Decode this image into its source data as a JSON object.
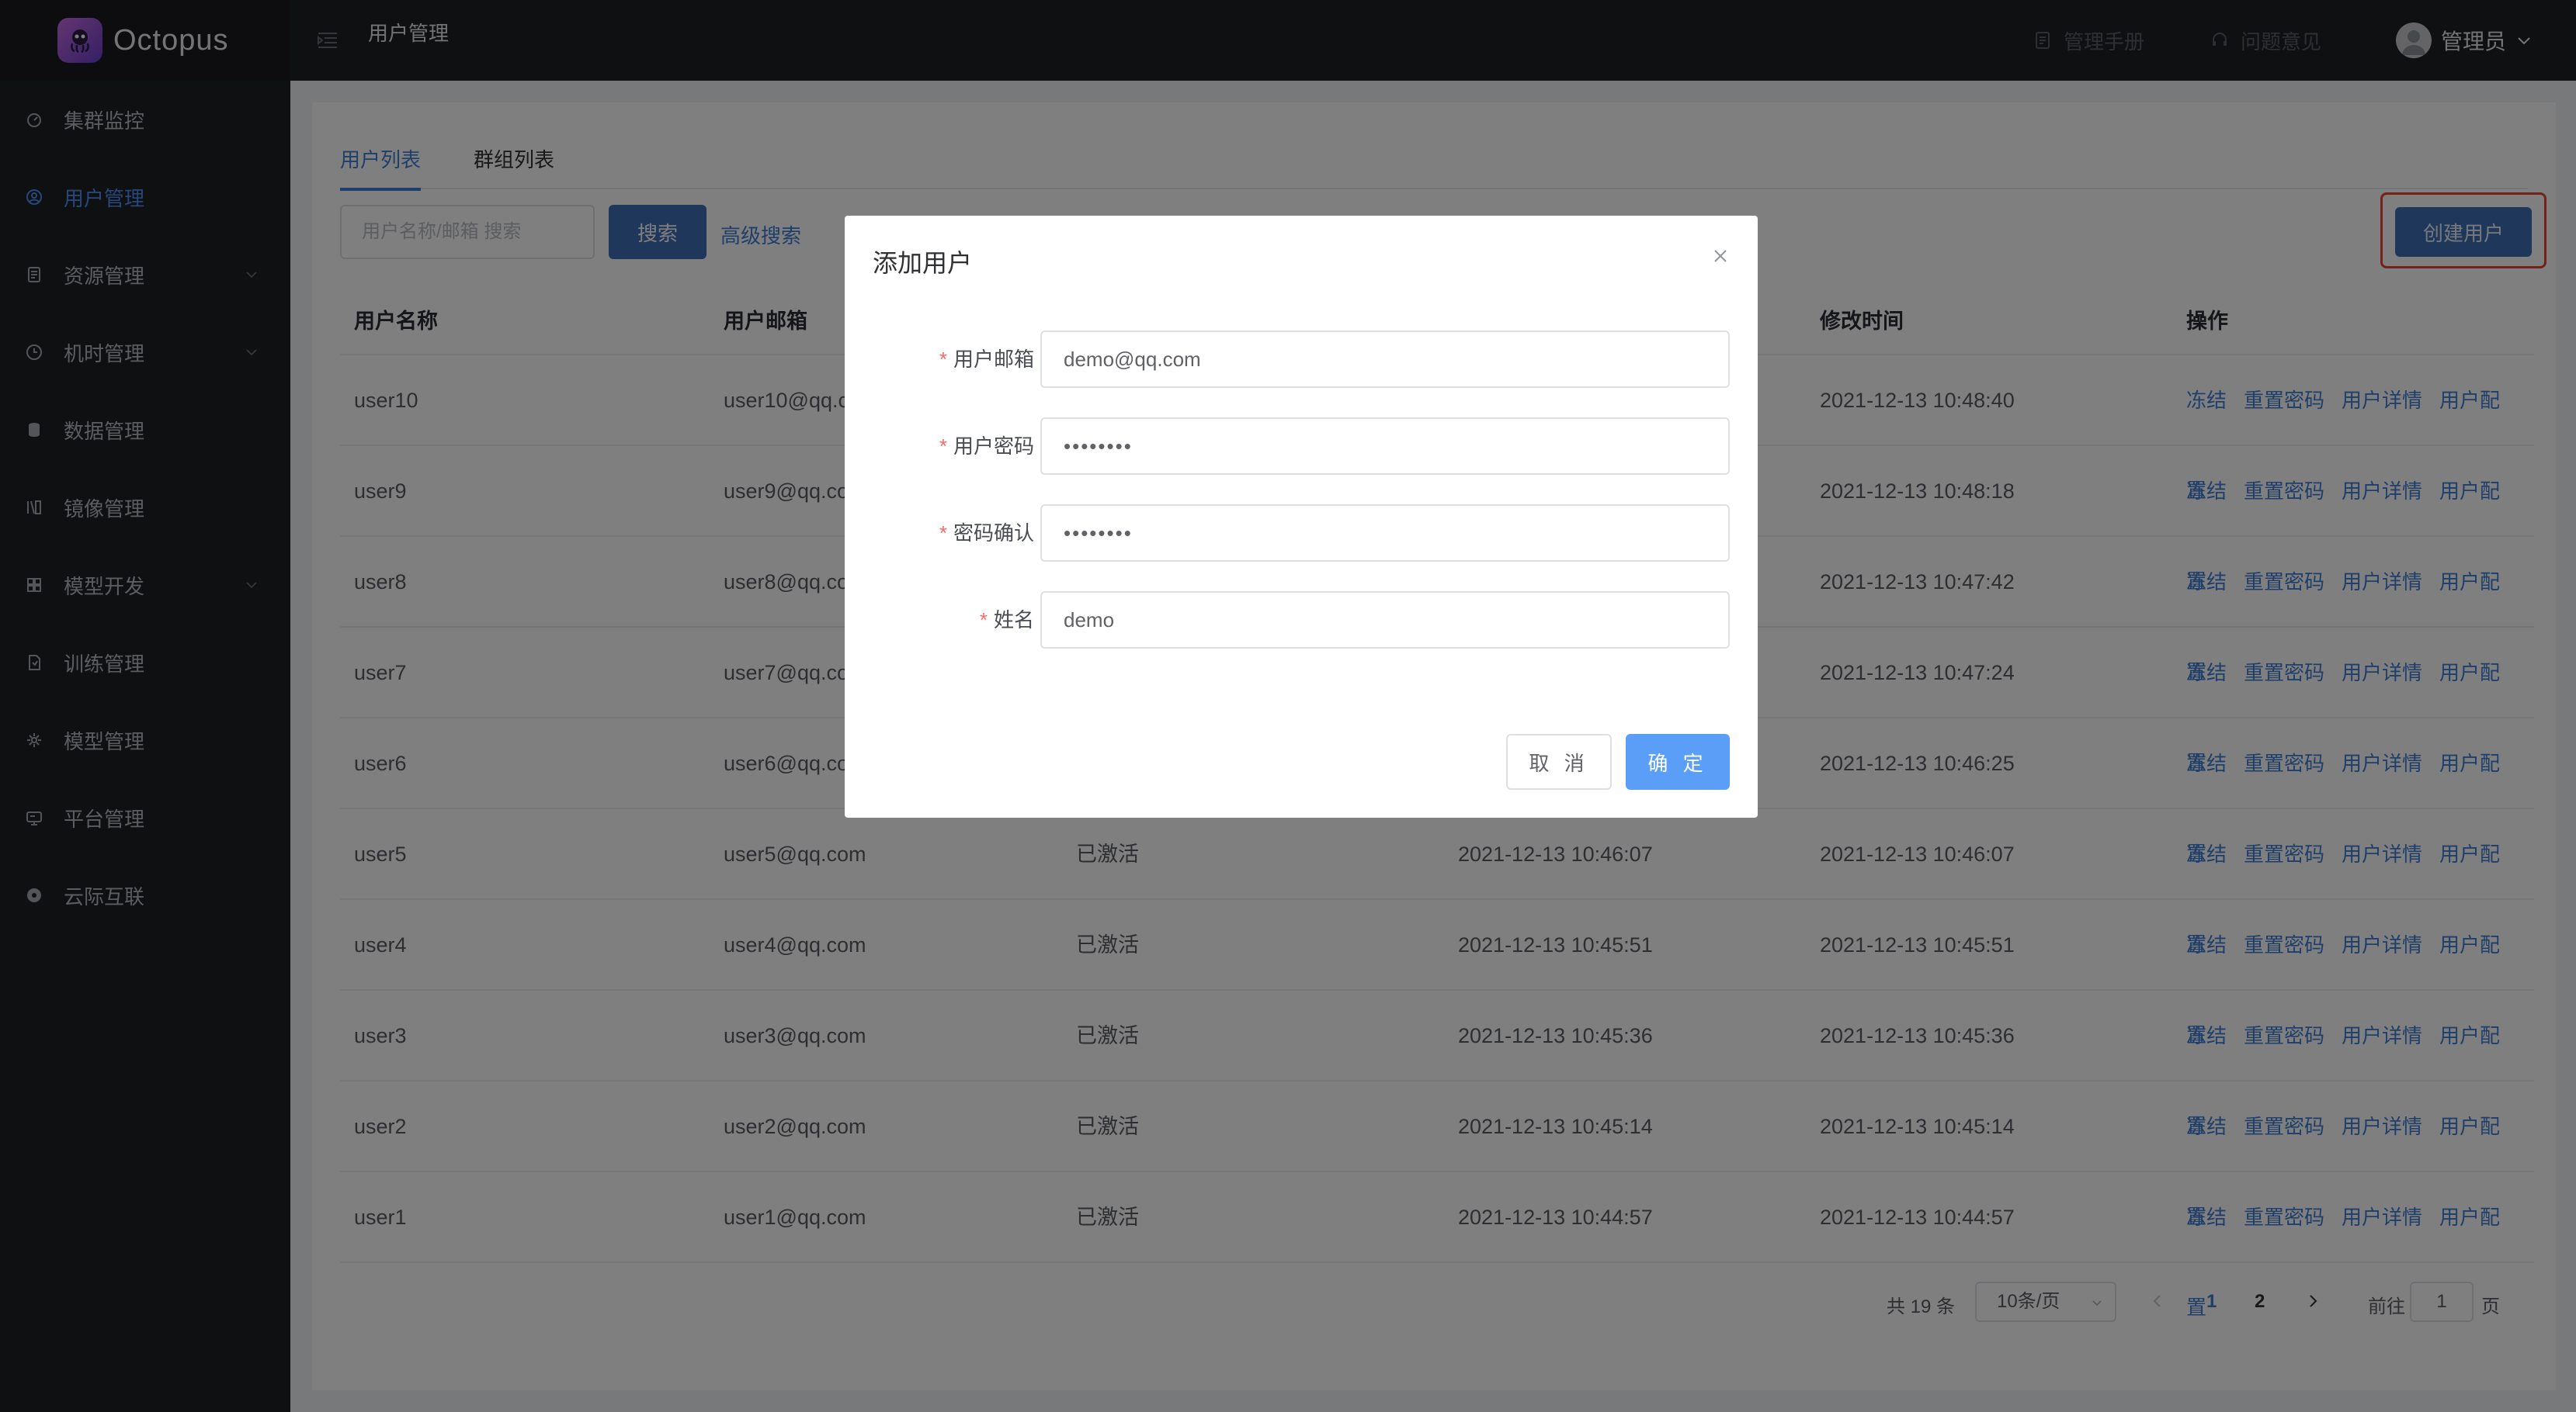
{
  "app": {
    "name": "Octopus",
    "page": "用户管理"
  },
  "sidebar": {
    "items": [
      {
        "label": "集群监控",
        "icon": "monitor-icon",
        "expandable": false,
        "active": false
      },
      {
        "label": "用户管理",
        "icon": "user-icon",
        "expandable": false,
        "active": true
      },
      {
        "label": "资源管理",
        "icon": "resource-icon",
        "expandable": true,
        "active": false
      },
      {
        "label": "机时管理",
        "icon": "clock-icon",
        "expandable": true,
        "active": false
      },
      {
        "label": "数据管理",
        "icon": "database-icon",
        "expandable": false,
        "active": false
      },
      {
        "label": "镜像管理",
        "icon": "image-icon",
        "expandable": false,
        "active": false
      },
      {
        "label": "模型开发",
        "icon": "dev-icon",
        "expandable": true,
        "active": false
      },
      {
        "label": "训练管理",
        "icon": "train-icon",
        "expandable": false,
        "active": false
      },
      {
        "label": "模型管理",
        "icon": "model-icon",
        "expandable": false,
        "active": false
      },
      {
        "label": "平台管理",
        "icon": "platform-icon",
        "expandable": false,
        "active": false
      },
      {
        "label": "云际互联",
        "icon": "cloud-icon",
        "expandable": false,
        "active": false
      }
    ]
  },
  "header": {
    "manual": "管理手册",
    "feedback": "问题意见",
    "user": "管理员"
  },
  "tabs": [
    {
      "label": "用户列表",
      "active": true
    },
    {
      "label": "群组列表",
      "active": false
    }
  ],
  "toolbar": {
    "search_placeholder": "用户名称/邮箱 搜索",
    "search_label": "搜索",
    "advanced_label": "高级搜索",
    "create_label": "创建用户"
  },
  "table": {
    "columns": [
      "用户名称",
      "用户邮箱",
      "修改时间",
      "操作"
    ],
    "ops": [
      "冻结",
      "重置密码",
      "用户详情",
      "用户配置"
    ],
    "rows": [
      {
        "name": "user10",
        "email": "user10@qq.c",
        "status": "",
        "created": "",
        "modified": "2021-12-13 10:48:40"
      },
      {
        "name": "user9",
        "email": "user9@qq.co",
        "status": "",
        "created": "",
        "modified": "2021-12-13 10:48:18"
      },
      {
        "name": "user8",
        "email": "user8@qq.co",
        "status": "",
        "created": "",
        "modified": "2021-12-13 10:47:42"
      },
      {
        "name": "user7",
        "email": "user7@qq.co",
        "status": "",
        "created": "",
        "modified": "2021-12-13 10:47:24"
      },
      {
        "name": "user6",
        "email": "user6@qq.co",
        "status": "",
        "created": "",
        "modified": "2021-12-13 10:46:25"
      },
      {
        "name": "user5",
        "email": "user5@qq.com",
        "status": "已激活",
        "created": "2021-12-13 10:46:07",
        "modified": "2021-12-13 10:46:07"
      },
      {
        "name": "user4",
        "email": "user4@qq.com",
        "status": "已激活",
        "created": "2021-12-13 10:45:51",
        "modified": "2021-12-13 10:45:51"
      },
      {
        "name": "user3",
        "email": "user3@qq.com",
        "status": "已激活",
        "created": "2021-12-13 10:45:36",
        "modified": "2021-12-13 10:45:36"
      },
      {
        "name": "user2",
        "email": "user2@qq.com",
        "status": "已激活",
        "created": "2021-12-13 10:45:14",
        "modified": "2021-12-13 10:45:14"
      },
      {
        "name": "user1",
        "email": "user1@qq.com",
        "status": "已激活",
        "created": "2021-12-13 10:44:57",
        "modified": "2021-12-13 10:44:57"
      }
    ]
  },
  "pagination": {
    "total": "共 19 条",
    "page_size": "10条/页",
    "pages": [
      "1",
      "2"
    ],
    "current": "1",
    "goto_label": "前往",
    "goto_value": "1",
    "page_suffix": "页"
  },
  "modal": {
    "title": "添加用户",
    "fields": [
      {
        "label": "用户邮箱",
        "value": "demo@qq.com",
        "type": "text"
      },
      {
        "label": "用户密码",
        "value": "••••••••",
        "type": "password"
      },
      {
        "label": "密码确认",
        "value": "••••••••",
        "type": "password"
      },
      {
        "label": "姓名",
        "value": "demo",
        "type": "text"
      }
    ],
    "cancel_label": "取 消",
    "ok_label": "确 定"
  },
  "colors": {
    "accent": "#3f7fd4",
    "primary_button": "#3f6fb5",
    "highlight": "#e8452f",
    "sidebar_bg": "#1f2024"
  }
}
